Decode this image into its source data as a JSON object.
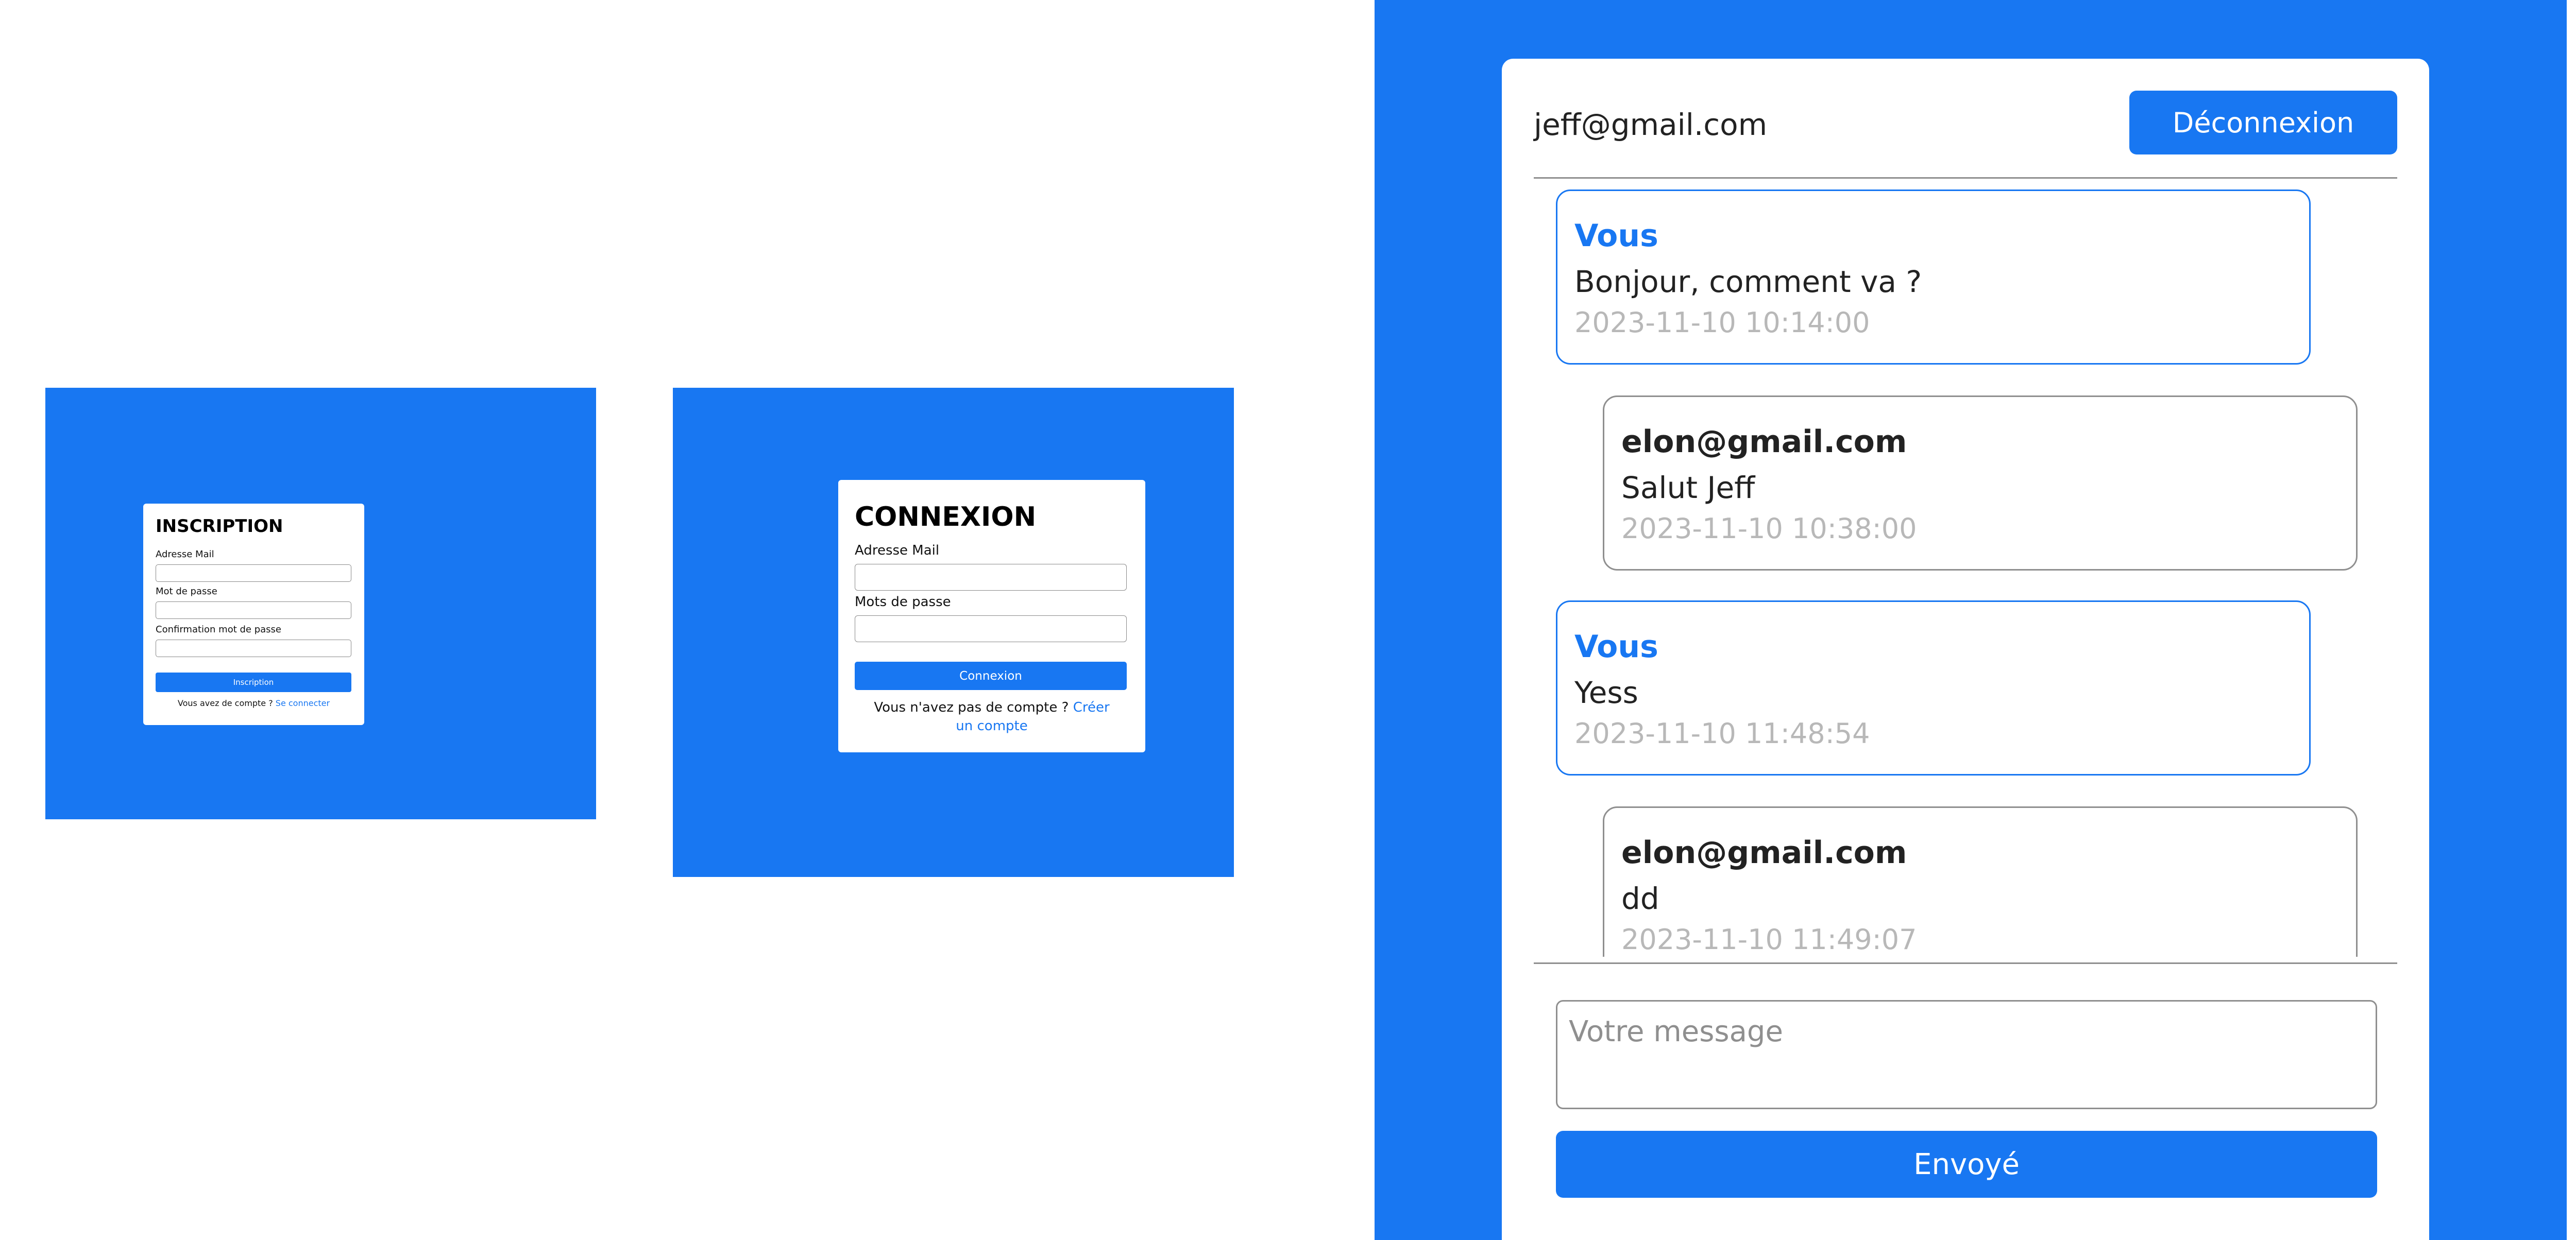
{
  "register": {
    "title": "INSCRIPTION",
    "email_label": "Adresse Mail",
    "password_label": "Mot de passe",
    "confirm_label": "Confirmation mot de passe",
    "submit_label": "Inscription",
    "footer_text": "Vous avez de compte ?",
    "footer_link": "Se connecter"
  },
  "login": {
    "title": "CONNEXION",
    "email_label": "Adresse Mail",
    "password_label": "Mots de passe",
    "submit_label": "Connexion",
    "footer_text": "Vous n'avez pas de compte ?",
    "footer_link": "Créer un compte"
  },
  "chat": {
    "user_email": "jeff@gmail.com",
    "logout_label": "Déconnexion",
    "messages": [
      {
        "sender": "Vous",
        "text": "Bonjour, comment va ?",
        "time": "2023-11-10 10:14:00",
        "own": true
      },
      {
        "sender": "elon@gmail.com",
        "text": "Salut Jeff",
        "time": "2023-11-10 10:38:00",
        "own": false
      },
      {
        "sender": "Vous",
        "text": "Yess",
        "time": "2023-11-10 11:48:54",
        "own": true
      },
      {
        "sender": "elon@gmail.com",
        "text": "dd",
        "time": "2023-11-10 11:49:07",
        "own": false
      }
    ],
    "compose_placeholder": "Votre message",
    "send_label": "Envoyé"
  },
  "colors": {
    "brand": "#1877F2",
    "border_gray": "#8f8f8f",
    "timestamp_gray": "#b8b8b8"
  }
}
